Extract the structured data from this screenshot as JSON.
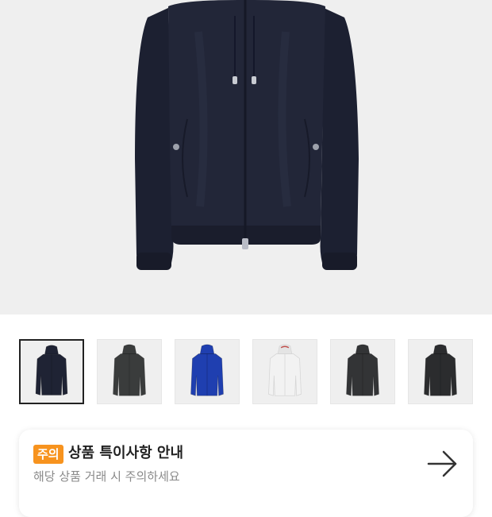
{
  "product": {
    "main_image": "navy-hooded-windbreaker-jacket",
    "colors": {
      "navy": "#1f2334",
      "charcoal": "#3a3c3c",
      "royal_blue": "#1f3fb0",
      "white": "#f2f2f2",
      "graphite": "#333436",
      "black": "#2b2c2e"
    }
  },
  "thumbnails": [
    {
      "name": "navy",
      "color": "#1f2334",
      "selected": true
    },
    {
      "name": "charcoal",
      "color": "#3a3c3c",
      "selected": false
    },
    {
      "name": "royal-blue",
      "color": "#1f3fb0",
      "selected": false
    },
    {
      "name": "white",
      "color": "#f2f2f2",
      "selected": false
    },
    {
      "name": "graphite",
      "color": "#333436",
      "selected": false
    },
    {
      "name": "black",
      "color": "#2b2c2e",
      "selected": false
    }
  ],
  "notice": {
    "badge": "주의",
    "title": "상품 특이사항 안내",
    "subtitle": "해당 상품 거래 시 주의하세요",
    "badge_color": "#f7931e",
    "arrow_icon": "arrow-right-icon"
  }
}
